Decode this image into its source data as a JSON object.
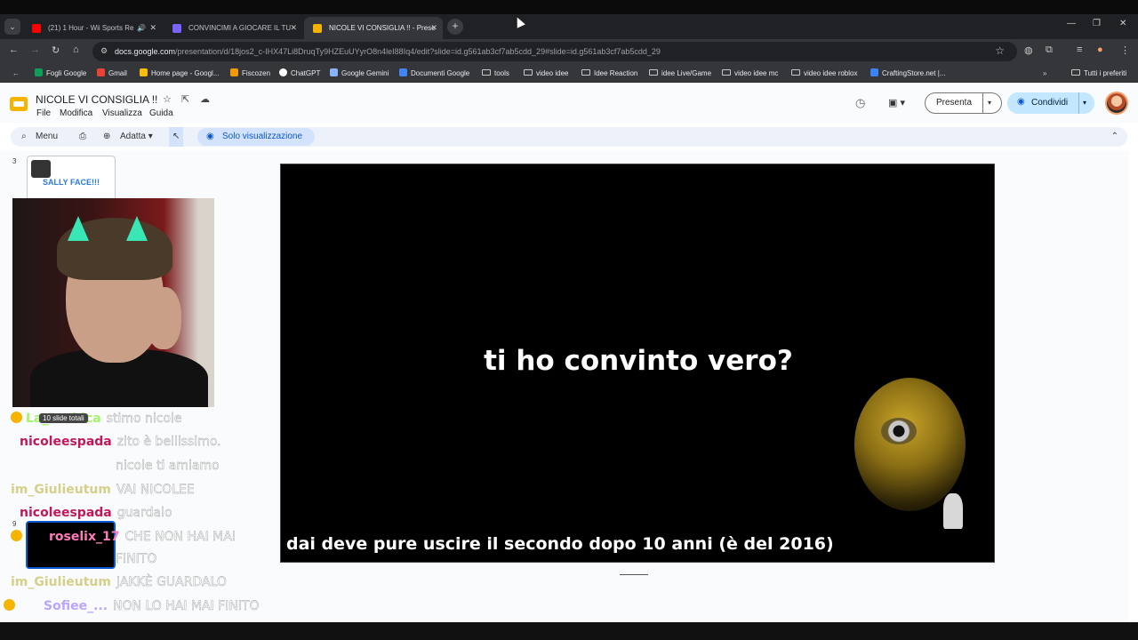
{
  "browser": {
    "tabs": [
      {
        "title": "(21) 1 Hour - Wii Sports Re",
        "active": false,
        "favicon_color": "#ff0000"
      },
      {
        "title": "CONVINCIMI A GIOCARE IL TU",
        "active": false,
        "favicon_color": "#7b61ff"
      },
      {
        "title": "NICOLE VI CONSIGLIA !! - Prese",
        "active": true,
        "favicon_color": "#f4b400"
      }
    ],
    "url_host": "docs.google.com",
    "url_path": "/presentation/d/18jos2_c-IHX47Li8DruqTy9HZEuUYyrO8n4leI88Iq4/edit?slide=id.g561ab3cf7ab5cdd_29#slide=id.g561ab3cf7ab5cdd_29",
    "bookmarks": [
      {
        "label": "Fogli Google",
        "icon": "sheets-icon",
        "color": "#0f9d58"
      },
      {
        "label": "Gmail",
        "icon": "gmail-icon",
        "color": "#ea4335"
      },
      {
        "label": "Home page - Googl...",
        "icon": "drive-icon",
        "color": "#fbbc04"
      },
      {
        "label": "Fiscozen",
        "icon": "fiscozen-icon",
        "color": "#f29900"
      },
      {
        "label": "ChatGPT",
        "icon": "chatgpt-icon",
        "color": "#ffffff"
      },
      {
        "label": "Google Gemini",
        "icon": "gemini-icon",
        "color": "#8ab4f8"
      },
      {
        "label": "Documenti Google",
        "icon": "docs-icon",
        "color": "#4285f4"
      },
      {
        "label": "tools",
        "icon": "folder-icon"
      },
      {
        "label": "video idee",
        "icon": "folder-icon"
      },
      {
        "label": "Idee Reaction",
        "icon": "folder-icon"
      },
      {
        "label": "idee Live/Game",
        "icon": "folder-icon"
      },
      {
        "label": "video idee mc",
        "icon": "folder-icon"
      },
      {
        "label": "video idee roblox",
        "icon": "folder-icon"
      },
      {
        "label": "CraftingStore.net |...",
        "icon": "craftingstore-icon",
        "color": "#3b82f6"
      }
    ],
    "all_bookmarks": "Tutti i preferiti"
  },
  "app": {
    "doc_title": "NICOLE VI CONSIGLIA !!",
    "menus": [
      "File",
      "Modifica",
      "Visualizza",
      "Guida"
    ],
    "present_label": "Presenta",
    "share_label": "Condividi",
    "toolbar": {
      "menu_label": "Menu",
      "zoom_label": "Adatta",
      "view_mode_label": "Solo visualizzazione"
    },
    "filmstrip": {
      "slide_3_number": "3",
      "slide_3_text": "SALLY FACE!!!",
      "slide_9_number": "9",
      "slide_count": "10 slide totali"
    },
    "slide": {
      "title": "ti ho convinto vero?",
      "subtitle": "dai deve pure uscire il secondo dopo 10 anni (è del 2016)"
    }
  },
  "chat": [
    {
      "user": "La_Lesbica",
      "color": "#a6f36b",
      "message": "stimo nicole"
    },
    {
      "user": "nicoleespada",
      "color": "#c2185b",
      "message": "zito è bellissimo."
    },
    {
      "user": "",
      "color": "#5bd1c9",
      "message": "nicole ti amiamo"
    },
    {
      "user": "im_Giulieutum",
      "color": "#d4d08a",
      "message": "VAI NICOLEE"
    },
    {
      "user": "nicoleespada",
      "color": "#c2185b",
      "message": "guardalo"
    },
    {
      "user": "roselix_17",
      "color": "#ff7ab8",
      "message": "CHE NON HAI MAI"
    },
    {
      "user": "",
      "color": "#ffffff",
      "message": "FINITO"
    },
    {
      "user": "im_Giulieutum",
      "color": "#d4d08a",
      "message": "JAKKÈ GUARDALO"
    },
    {
      "user": "Sofiee_...",
      "color": "#b9a6ff",
      "message": "NON LO HAI MAI FINITO"
    }
  ]
}
